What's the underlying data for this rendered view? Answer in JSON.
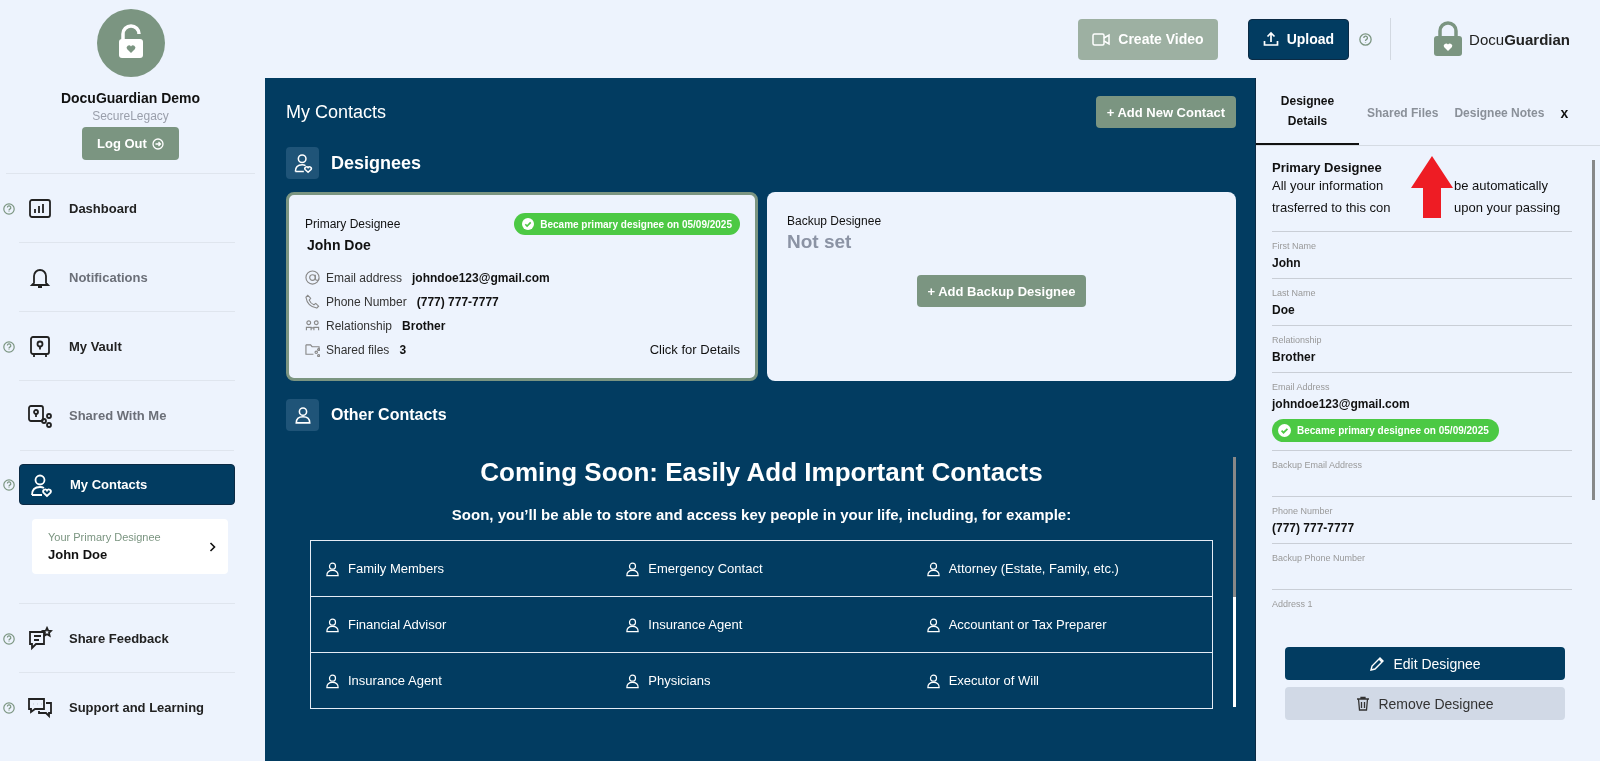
{
  "sidebar": {
    "profile": {
      "name": "DocuGuardian Demo",
      "subtitle": "SecureLegacy"
    },
    "logout": "Log Out",
    "nav": [
      {
        "label": "Dashboard",
        "help": true,
        "disabled": false,
        "selected": false
      },
      {
        "label": "Notifications",
        "help": false,
        "disabled": true,
        "selected": false
      },
      {
        "label": "My Vault",
        "help": true,
        "disabled": false,
        "selected": false
      },
      {
        "label": "Shared With Me",
        "help": false,
        "disabled": true,
        "selected": false
      },
      {
        "label": "My Contacts",
        "help": true,
        "disabled": false,
        "selected": true
      },
      {
        "label": "Share Feedback",
        "help": true,
        "disabled": false,
        "selected": false
      },
      {
        "label": "Support and Learning",
        "help": true,
        "disabled": false,
        "selected": false
      }
    ],
    "primary_designee": {
      "label": "Your Primary Designee",
      "name": "John Doe"
    }
  },
  "topbar": {
    "create_video": {
      "label": "Create Video",
      "disabled": true
    },
    "upload": {
      "label": "Upload"
    },
    "logo": "Docu**Guardian**"
  },
  "main": {
    "title": "My Contacts",
    "add_button": "+ Add New Contact",
    "designees": {
      "title": "Designees",
      "primary": {
        "label": "Primary Designee",
        "badge": "Became primary designee on 05/09/2025",
        "name": "John Doe",
        "details": [
          {
            "label": "Email address",
            "value": "johndoe123@gmail.com"
          },
          {
            "label": "Phone Number",
            "value": "(777) 777-7777"
          },
          {
            "label": "Relationship",
            "value": "Brother"
          },
          {
            "label": "Shared files",
            "value": "3"
          }
        ],
        "link": "Click for Details"
      },
      "backup": {
        "label": "Backup Designee",
        "name": "Not set",
        "button": "+ Add Backup Designee"
      }
    },
    "other_contacts": {
      "title": "Other Contacts",
      "heading": "Coming Soon: Easily Add Important Contacts",
      "subtitle": "Soon, you’ll be able to store and access key people in your life, including, for example:",
      "rows": [
        [
          "Family Members",
          "Emergency Contact",
          "Attorney (Estate, Family, etc.)"
        ],
        [
          "Financial Advisor",
          "Insurance Agent",
          "Accountant or Tax Preparer"
        ],
        [
          "Insurance Agent",
          "Physicians",
          "Executor of Will"
        ]
      ]
    }
  },
  "panel": {
    "tabs": [
      {
        "label": "Designee Details",
        "selected": true
      },
      {
        "label": "Shared Files",
        "selected": false
      },
      {
        "label": "Designee Notes",
        "selected": false
      }
    ],
    "close": "x",
    "heading": "Primary Designee",
    "description_lines": [
      [
        "All your information",
        "be automatically"
      ],
      [
        "trasferred to this con",
        "upon your passing"
      ]
    ],
    "fields": [
      {
        "label": "First Name",
        "value": "John"
      },
      {
        "label": "Last Name",
        "value": "Doe"
      },
      {
        "label": "Relationship",
        "value": "Brother"
      },
      {
        "label": "Email Address",
        "value": "johndoe123@gmail.com",
        "badge": "Became primary designee on 05/09/2025"
      },
      {
        "label": "Backup Email Address"
      },
      {
        "label": "Phone Number",
        "value": "(777) 777-7777"
      },
      {
        "label": "Backup Phone Number"
      },
      {
        "label": "Address 1"
      }
    ],
    "edit_button": "Edit Designee",
    "remove_button": "Remove Designee"
  }
}
